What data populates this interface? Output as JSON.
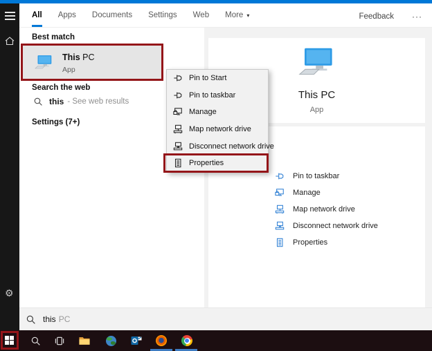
{
  "topbar": {
    "tabs": [
      "All",
      "Apps",
      "Documents",
      "Settings",
      "Web",
      "More"
    ],
    "active_tab": "All",
    "feedback_label": "Feedback",
    "overflow_label": "···"
  },
  "icons": {
    "chevron_down": "▾",
    "gear": "⚙"
  },
  "results": {
    "best_match_header": "Best match",
    "best_match": {
      "title_primary": "This",
      "title_secondary": " PC",
      "subtitle": "App"
    },
    "web_header": "Search the web",
    "web_item": {
      "query": "this",
      "hint": "- See web results"
    },
    "settings_header": "Settings (7+)"
  },
  "context_menu": {
    "items": [
      "Pin to Start",
      "Pin to taskbar",
      "Manage",
      "Map network drive",
      "Disconnect network drive",
      "Properties"
    ],
    "annotated_item": "Properties"
  },
  "preview": {
    "title": "This PC",
    "subtitle": "App",
    "actions": [
      "Pin to taskbar",
      "Manage",
      "Map network drive",
      "Disconnect network drive",
      "Properties"
    ]
  },
  "search_bar": {
    "typed": "this",
    "suggestion": "PC"
  },
  "taskbar": {
    "apps": [
      "start",
      "search",
      "task-view",
      "file-explorer",
      "globe",
      "outlook",
      "firefox",
      "chrome"
    ],
    "running": [
      "firefox",
      "chrome"
    ]
  },
  "annotations": {
    "color": "#941519",
    "boxes": [
      "best-match-this-pc",
      "menu-item-properties",
      "start-button"
    ]
  },
  "colors": {
    "accent": "#0078d7",
    "taskbar_indicator": "#3e7cc2"
  }
}
